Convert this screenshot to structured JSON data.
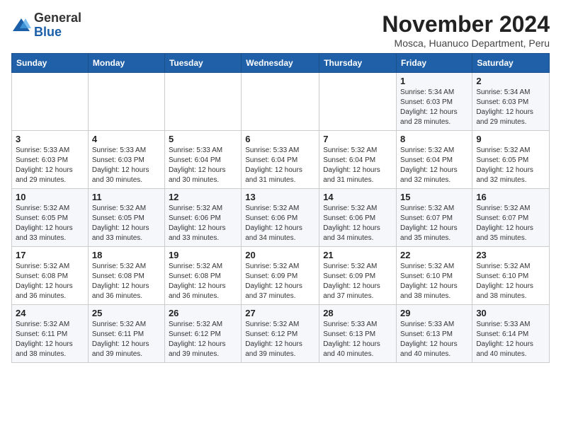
{
  "logo": {
    "general": "General",
    "blue": "Blue"
  },
  "title": "November 2024",
  "subtitle": "Mosca, Huanuco Department, Peru",
  "days_of_week": [
    "Sunday",
    "Monday",
    "Tuesday",
    "Wednesday",
    "Thursday",
    "Friday",
    "Saturday"
  ],
  "weeks": [
    [
      {
        "day": "",
        "info": ""
      },
      {
        "day": "",
        "info": ""
      },
      {
        "day": "",
        "info": ""
      },
      {
        "day": "",
        "info": ""
      },
      {
        "day": "",
        "info": ""
      },
      {
        "day": "1",
        "info": "Sunrise: 5:34 AM\nSunset: 6:03 PM\nDaylight: 12 hours and 28 minutes."
      },
      {
        "day": "2",
        "info": "Sunrise: 5:34 AM\nSunset: 6:03 PM\nDaylight: 12 hours and 29 minutes."
      }
    ],
    [
      {
        "day": "3",
        "info": "Sunrise: 5:33 AM\nSunset: 6:03 PM\nDaylight: 12 hours and 29 minutes."
      },
      {
        "day": "4",
        "info": "Sunrise: 5:33 AM\nSunset: 6:03 PM\nDaylight: 12 hours and 30 minutes."
      },
      {
        "day": "5",
        "info": "Sunrise: 5:33 AM\nSunset: 6:04 PM\nDaylight: 12 hours and 30 minutes."
      },
      {
        "day": "6",
        "info": "Sunrise: 5:33 AM\nSunset: 6:04 PM\nDaylight: 12 hours and 31 minutes."
      },
      {
        "day": "7",
        "info": "Sunrise: 5:32 AM\nSunset: 6:04 PM\nDaylight: 12 hours and 31 minutes."
      },
      {
        "day": "8",
        "info": "Sunrise: 5:32 AM\nSunset: 6:04 PM\nDaylight: 12 hours and 32 minutes."
      },
      {
        "day": "9",
        "info": "Sunrise: 5:32 AM\nSunset: 6:05 PM\nDaylight: 12 hours and 32 minutes."
      }
    ],
    [
      {
        "day": "10",
        "info": "Sunrise: 5:32 AM\nSunset: 6:05 PM\nDaylight: 12 hours and 33 minutes."
      },
      {
        "day": "11",
        "info": "Sunrise: 5:32 AM\nSunset: 6:05 PM\nDaylight: 12 hours and 33 minutes."
      },
      {
        "day": "12",
        "info": "Sunrise: 5:32 AM\nSunset: 6:06 PM\nDaylight: 12 hours and 33 minutes."
      },
      {
        "day": "13",
        "info": "Sunrise: 5:32 AM\nSunset: 6:06 PM\nDaylight: 12 hours and 34 minutes."
      },
      {
        "day": "14",
        "info": "Sunrise: 5:32 AM\nSunset: 6:06 PM\nDaylight: 12 hours and 34 minutes."
      },
      {
        "day": "15",
        "info": "Sunrise: 5:32 AM\nSunset: 6:07 PM\nDaylight: 12 hours and 35 minutes."
      },
      {
        "day": "16",
        "info": "Sunrise: 5:32 AM\nSunset: 6:07 PM\nDaylight: 12 hours and 35 minutes."
      }
    ],
    [
      {
        "day": "17",
        "info": "Sunrise: 5:32 AM\nSunset: 6:08 PM\nDaylight: 12 hours and 36 minutes."
      },
      {
        "day": "18",
        "info": "Sunrise: 5:32 AM\nSunset: 6:08 PM\nDaylight: 12 hours and 36 minutes."
      },
      {
        "day": "19",
        "info": "Sunrise: 5:32 AM\nSunset: 6:08 PM\nDaylight: 12 hours and 36 minutes."
      },
      {
        "day": "20",
        "info": "Sunrise: 5:32 AM\nSunset: 6:09 PM\nDaylight: 12 hours and 37 minutes."
      },
      {
        "day": "21",
        "info": "Sunrise: 5:32 AM\nSunset: 6:09 PM\nDaylight: 12 hours and 37 minutes."
      },
      {
        "day": "22",
        "info": "Sunrise: 5:32 AM\nSunset: 6:10 PM\nDaylight: 12 hours and 38 minutes."
      },
      {
        "day": "23",
        "info": "Sunrise: 5:32 AM\nSunset: 6:10 PM\nDaylight: 12 hours and 38 minutes."
      }
    ],
    [
      {
        "day": "24",
        "info": "Sunrise: 5:32 AM\nSunset: 6:11 PM\nDaylight: 12 hours and 38 minutes."
      },
      {
        "day": "25",
        "info": "Sunrise: 5:32 AM\nSunset: 6:11 PM\nDaylight: 12 hours and 39 minutes."
      },
      {
        "day": "26",
        "info": "Sunrise: 5:32 AM\nSunset: 6:12 PM\nDaylight: 12 hours and 39 minutes."
      },
      {
        "day": "27",
        "info": "Sunrise: 5:32 AM\nSunset: 6:12 PM\nDaylight: 12 hours and 39 minutes."
      },
      {
        "day": "28",
        "info": "Sunrise: 5:33 AM\nSunset: 6:13 PM\nDaylight: 12 hours and 40 minutes."
      },
      {
        "day": "29",
        "info": "Sunrise: 5:33 AM\nSunset: 6:13 PM\nDaylight: 12 hours and 40 minutes."
      },
      {
        "day": "30",
        "info": "Sunrise: 5:33 AM\nSunset: 6:14 PM\nDaylight: 12 hours and 40 minutes."
      }
    ]
  ]
}
